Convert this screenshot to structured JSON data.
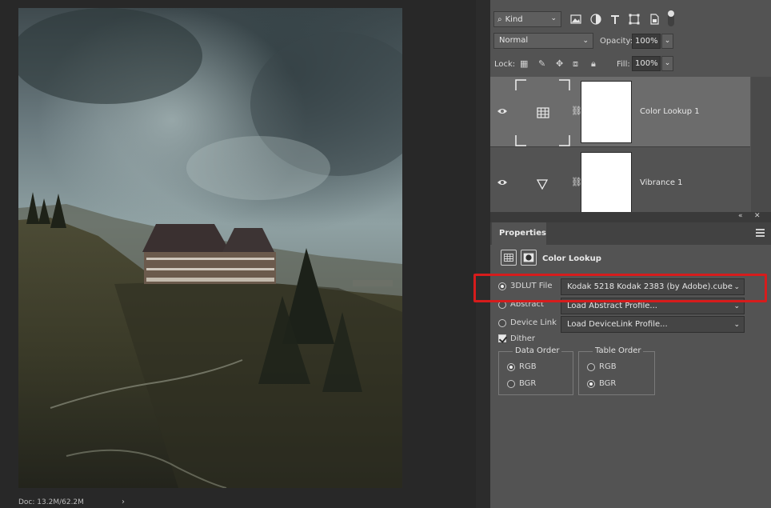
{
  "status": {
    "doc_info": "Doc: 13.2M/62.2M",
    "arrow": "›"
  },
  "layers": {
    "filter_kind": "Kind",
    "filter_icons": [
      "image-filter-icon",
      "adjustment-filter-icon",
      "type-filter-icon",
      "shape-filter-icon",
      "smart-object-filter-icon"
    ],
    "blend_mode": "Normal",
    "opacity_label": "Opacity:",
    "opacity_value": "100%",
    "lock_label": "Lock:",
    "fill_label": "Fill:",
    "fill_value": "100%",
    "items": [
      {
        "name": "Color Lookup 1",
        "selected": true,
        "thumb": "lookup-table-icon"
      },
      {
        "name": "Vibrance 1",
        "selected": false,
        "thumb": "vibrance-triangle-icon"
      }
    ]
  },
  "properties": {
    "tab_label": "Properties",
    "type_label": "Color Lookup",
    "options": [
      {
        "label": "3DLUT File",
        "selected": true,
        "value": "Kodak 5218 Kodak 2383 (by Adobe).cube"
      },
      {
        "label": "Abstract",
        "selected": false,
        "value": "Load Abstract Profile..."
      },
      {
        "label": "Device Link",
        "selected": false,
        "value": "Load DeviceLink Profile..."
      }
    ],
    "dither_label": "Dither",
    "dither_checked": true,
    "data_order": {
      "title": "Data Order",
      "options": [
        "RGB",
        "BGR"
      ],
      "selected": "RGB"
    },
    "table_order": {
      "title": "Table Order",
      "options": [
        "RGB",
        "BGR"
      ],
      "selected": "BGR"
    }
  },
  "colors": {
    "highlight": "#d61c1c",
    "panel": "#535353",
    "selected_layer": "#6c6c6c"
  }
}
